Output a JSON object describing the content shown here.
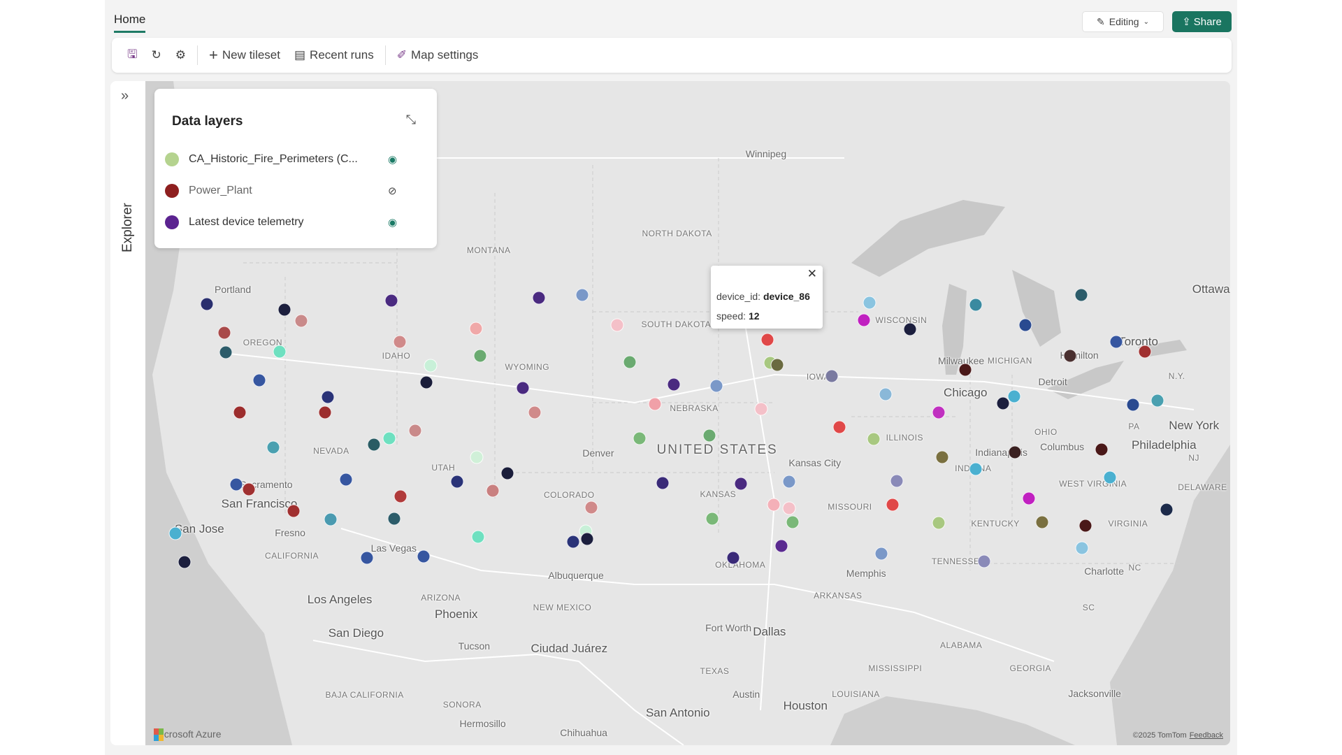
{
  "header": {
    "tab": "Home",
    "editing_label": "Editing",
    "share_label": "Share"
  },
  "toolbar": {
    "new_tileset": "New tileset",
    "recent_runs": "Recent runs",
    "map_settings": "Map settings"
  },
  "explorer": {
    "label": "Explorer"
  },
  "data_layers": {
    "title": "Data layers",
    "items": [
      {
        "name": "CA_Historic_Fire_Perimeters (C...",
        "color": "#b5d38f",
        "visible": true
      },
      {
        "name": "Power_Plant",
        "color": "#8e1f1f",
        "visible": false
      },
      {
        "name": "Latest device telemetry",
        "color": "#5b2390",
        "visible": true
      }
    ]
  },
  "tooltip": {
    "k1": "device_id:",
    "v1": "device_86",
    "k2": "speed:",
    "v2": "12",
    "close": "✕"
  },
  "map": {
    "attribution_logo": "Microsoft Azure",
    "copyright": "©2025 TomTom",
    "feedback": "Feedback",
    "labels": [
      "Winnipeg",
      "NORTH DAKOTA",
      "MONTANA",
      "Portland",
      "OREGON",
      "IDAHO",
      "WYOMING",
      "SOUTH DAKOTA",
      "NEBRASKA",
      "IOWA",
      "WISCONSIN",
      "Milwaukee",
      "MICHIGAN",
      "Hamilton",
      "Toronto",
      "Ottawa",
      "Detroit",
      "Chicago",
      "N.Y.",
      "PA",
      "New York",
      "Philadelphia",
      "NJ",
      "OHIO",
      "Columbus",
      "Indianapolis",
      "INDIANA",
      "ILLINOIS",
      "UNITED STATES",
      "Denver",
      "Kansas City",
      "NEVADA",
      "UTAH",
      "Sacramento",
      "San Francisco",
      "COLORADO",
      "KANSAS",
      "MISSOURI",
      "WEST VIRGINIA",
      "DELAWARE",
      "KENTUCKY",
      "VIRGINIA",
      "San Jose",
      "Fresno",
      "Las Vegas",
      "CALIFORNIA",
      "OKLAHOMA",
      "Memphis",
      "TENNESSEE",
      "Charlotte",
      "NC",
      "SC",
      "Albuquerque",
      "ARIZONA",
      "Los Angeles",
      "Phoenix",
      "NEW MEXICO",
      "ARKANSAS",
      "San Diego",
      "Dallas",
      "Fort Worth",
      "ALABAMA",
      "GEORGIA",
      "Tucson",
      "Ciudad Juárez",
      "TEXAS",
      "MISSISSIPPI",
      "Jacksonville",
      "LOUISIANA",
      "Austin",
      "Houston",
      "BAJA CALIFORNIA",
      "SONORA",
      "San Antonio",
      "Hermosillo",
      "Chihuahua"
    ]
  },
  "colors": {
    "accent": "#1a7560",
    "land": "#e6e6e6",
    "water": "#cfcfcf"
  }
}
